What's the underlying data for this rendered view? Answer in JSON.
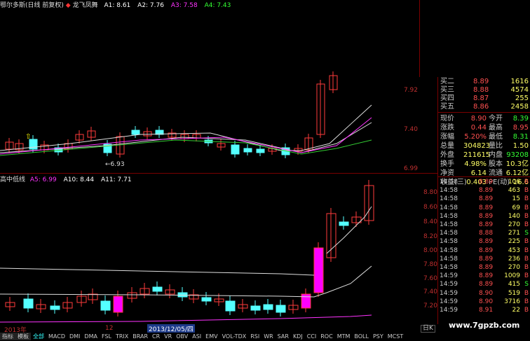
{
  "chart_header": {
    "title": "鄂尔多斯(日线 前复权)",
    "indicator_name": "龙飞凤舞",
    "indicators": [
      {
        "label": "A1: 8.61",
        "color": "#ffffff"
      },
      {
        "label": "A2: 7.76",
        "color": "#ffffff"
      },
      {
        "label": "A3: 7.58",
        "color": "#ff33ff"
      },
      {
        "label": "A4: 7.43",
        "color": "#33ff33"
      }
    ]
  },
  "sub_header": {
    "title": "高中低线",
    "indicators": [
      {
        "label": "A5: 6.99",
        "color": "#ff33ff"
      },
      {
        "label": "A10: 8.44",
        "color": "#ffffff"
      },
      {
        "label": "A11: 7.71",
        "color": "#ffffff"
      }
    ]
  },
  "main_y_labels": [
    "7.92",
    "7.40",
    "6.99"
  ],
  "sub_y_labels": [
    "8.80",
    "8.60",
    "8.40",
    "8.20",
    "8.00",
    "7.80",
    "7.60",
    "7.40",
    "7.20"
  ],
  "low_marker": "6.93",
  "quote": {
    "ask_rows": [
      {
        "name": "买二",
        "price": "8.89",
        "vol": "1616"
      },
      {
        "name": "买三",
        "price": "8.88",
        "vol": "4574"
      },
      {
        "name": "买四",
        "price": "8.87",
        "vol": "255"
      },
      {
        "name": "买五",
        "price": "8.86",
        "vol": "2458"
      }
    ],
    "stats": [
      {
        "k1": "现价",
        "v1": "8.90",
        "k2": "今开",
        "v2": "8.39"
      },
      {
        "k1": "涨跌",
        "v1": "0.44",
        "k2": "最高",
        "v2": "8.95"
      },
      {
        "k1": "涨幅",
        "v1": "5.20%",
        "k2": "最低",
        "v2": "8.31"
      },
      {
        "k1": "总量",
        "v1": "304823",
        "k2": "量比",
        "v2": "1.50"
      },
      {
        "k1": "外盘",
        "v1": "211615",
        "k2": "内盘",
        "v2": "93208"
      },
      {
        "k1": "换手",
        "v1": "4.98%",
        "k2": "股本",
        "v2": "10.3亿"
      },
      {
        "k1": "净资",
        "v1": "6.14",
        "k2": "流通",
        "v2": "6.12亿"
      },
      {
        "k1": "收益(三)",
        "v1": "0.403",
        "k2": "PE(动)",
        "v2": "16.6"
      }
    ]
  },
  "ticks": [
    {
      "time": "14:58",
      "price": "8.89",
      "vol": "106",
      "side": "B"
    },
    {
      "time": "14:58",
      "price": "8.89",
      "vol": "463",
      "side": "B"
    },
    {
      "time": "14:58",
      "price": "8.89",
      "vol": "15",
      "side": "B"
    },
    {
      "time": "14:58",
      "price": "8.89",
      "vol": "69",
      "side": "B"
    },
    {
      "time": "14:58",
      "price": "8.89",
      "vol": "140",
      "side": "B"
    },
    {
      "time": "14:58",
      "price": "8.89",
      "vol": "270",
      "side": "B"
    },
    {
      "time": "14:58",
      "price": "8.88",
      "vol": "271",
      "side": "S"
    },
    {
      "time": "14:58",
      "price": "8.89",
      "vol": "225",
      "side": "B"
    },
    {
      "time": "14:58",
      "price": "8.89",
      "vol": "453",
      "side": "B"
    },
    {
      "time": "14:58",
      "price": "8.89",
      "vol": "236",
      "side": "B"
    },
    {
      "time": "14:58",
      "price": "8.89",
      "vol": "270",
      "side": "B"
    },
    {
      "time": "14:59",
      "price": "8.89",
      "vol": "1009",
      "side": "B"
    },
    {
      "time": "14:59",
      "price": "8.89",
      "vol": "415",
      "side": "S"
    },
    {
      "time": "14:59",
      "price": "8.90",
      "vol": "519",
      "side": "B"
    },
    {
      "time": "14:59",
      "price": "8.90",
      "vol": "3716",
      "side": "B"
    },
    {
      "time": "14:59",
      "price": "8.91",
      "vol": "22",
      "side": "B"
    }
  ],
  "date_bar": {
    "year": "2013年",
    "mid": "12",
    "selected_date": "2013/12/05/四",
    "right": "日K"
  },
  "bottom_tabs": [
    "指标",
    "模板",
    "全部",
    "MACD",
    "DMI",
    "DMA",
    "FSL",
    "TRIX",
    "BRAR",
    "CR",
    "VR",
    "OBV",
    "ASI",
    "EMV",
    "VOL-TDX",
    "RSI",
    "WR",
    "SAR",
    "KDJ",
    "CCI",
    "ROC",
    "MTM",
    "BOLL",
    "PSY",
    "MCST"
  ],
  "watermark": "www.7gpzb.com",
  "colors": {
    "up": "#ff3b3b",
    "down": "#54ffff",
    "magenta": "#ff00ff",
    "yellow": "#ffff00",
    "green": "#00cc00"
  }
}
